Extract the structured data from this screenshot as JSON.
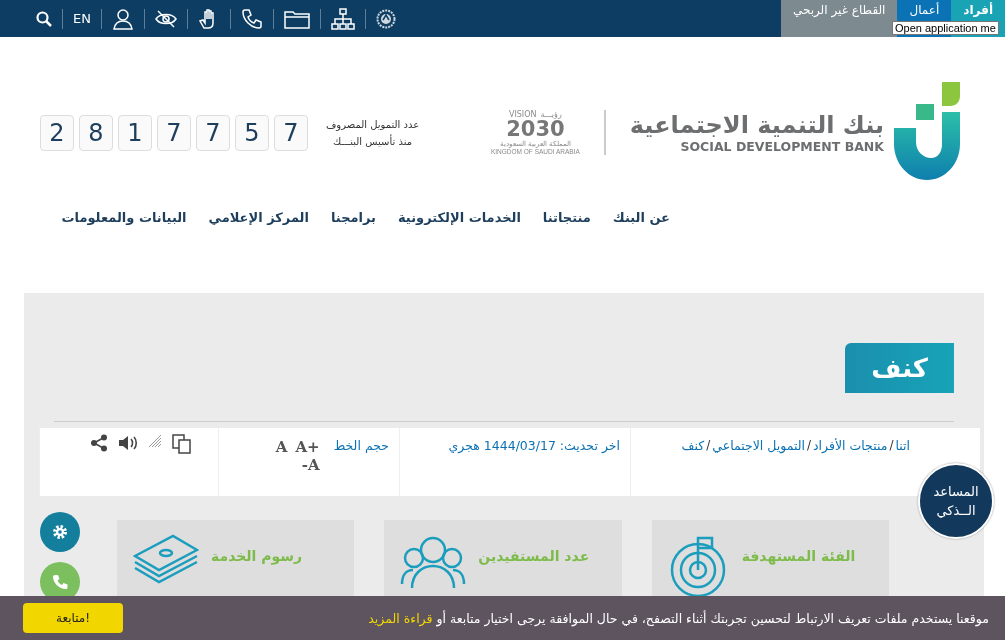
{
  "top_bar": {
    "language": "EN",
    "tabs": [
      {
        "label": "أفراد",
        "selected": true,
        "color": "#1aa3b5"
      },
      {
        "label": "أعمال",
        "selected": false,
        "color": "#0b72b5"
      },
      {
        "label": "القطاع غير الربحي",
        "selected": false,
        "color": "#7d8a90"
      }
    ],
    "tooltip": "Open application me"
  },
  "logo": {
    "name_ar": "بنك التنمية الاجتماعية",
    "name_en": "SOCIAL DEVELOPMENT BANK"
  },
  "vision": {
    "label": "VISION",
    "label_ar": "رؤيـــة",
    "year": "2030",
    "country_ar": "المملكة العربية السعودية",
    "country_en": "KINGDOM OF SAUDI ARABIA"
  },
  "counter": {
    "label": "عدد التمويل المصروف",
    "sublabel": "منذ تأسيس البنـــك",
    "digits": [
      "7",
      "5",
      "7",
      "7",
      "1",
      "8",
      "2"
    ]
  },
  "nav": [
    "عن البنك",
    "منتجاتنا",
    "الخدمات الإلكترونية",
    "برامجنا",
    "المركز الإعلامي",
    "البيانات والمعلومات"
  ],
  "page_title": "كنف",
  "breadcrumb": {
    "separator": "/",
    "items": [
      "اتنا",
      "منتجات الأفراد",
      "التمويل الاجتماعي",
      "كنف"
    ]
  },
  "updated": "اخر تحديث: 1444/03/17 هجري",
  "font_size": {
    "label": "حجم الخط",
    "increase": "A+",
    "normal": "A",
    "decrease": "A-"
  },
  "assistant": {
    "line1": "المساعد",
    "line2": "الــذكي"
  },
  "cards": [
    {
      "title": "الفئة المستهدفة",
      "kind": "target"
    },
    {
      "title": "عدد المستفيدين",
      "kind": "people"
    },
    {
      "title": "رسوم الخدمة",
      "kind": "money"
    }
  ],
  "cookie": {
    "text": "موقعنا يستخدم ملفات تعريف الارتباط لتحسين تجربتك أثناء التصفح، في حال الموافقة يرجى اختيار متابعة أو",
    "link": "قراءة المزيد",
    "button": "متابعة!"
  }
}
